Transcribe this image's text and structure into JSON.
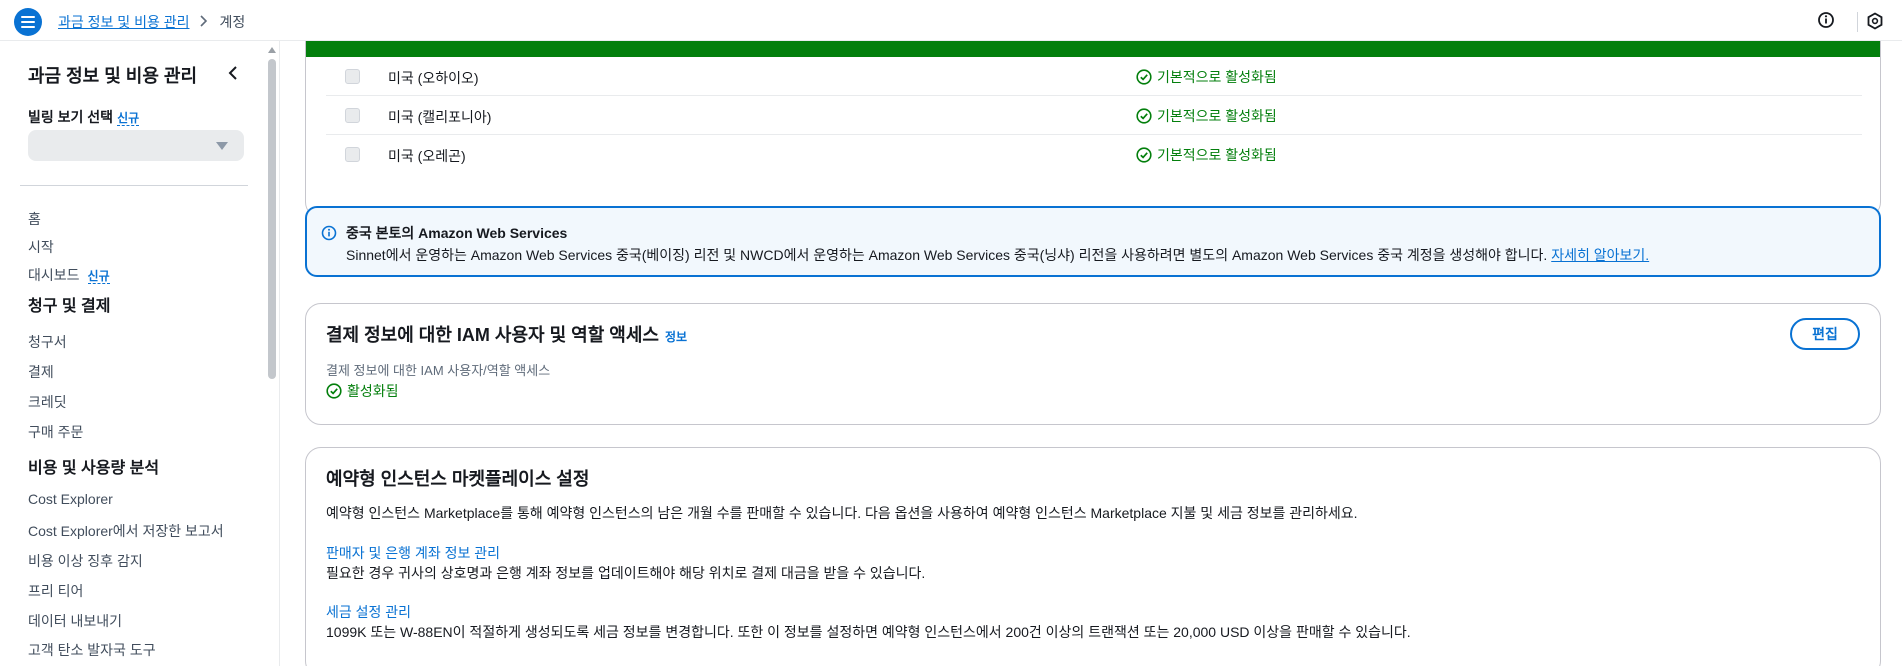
{
  "header": {
    "breadcrumb": [
      "과금 정보 및 비용 관리",
      "계정"
    ],
    "menu_icon": "hamburger-menu-icon",
    "info_icon": "info-icon",
    "settings_icon": "hexagon-settings-icon"
  },
  "sidebar": {
    "title": "과금 정보 및 비용 관리",
    "billing_view_label": "빌링 보기 선택",
    "new_badge": "신규",
    "select_value": "",
    "items_top": [
      "홈",
      "시작"
    ],
    "dashboard_label": "대시보드",
    "section_billing": "청구 및 결제",
    "billing_items": [
      "청구서",
      "결제",
      "크레딧",
      "구매 주문"
    ],
    "section_cost": "비용 및 사용량 분석",
    "cost_items": [
      "Cost Explorer",
      "Cost Explorer에서 저장한 보고서",
      "비용 이상 징후 감지",
      "프리 티어",
      "데이터 내보내기",
      "고객 탄소 발자국 도구"
    ]
  },
  "regions": {
    "rows": [
      {
        "name": "미국 (오하이오)",
        "status": "기본적으로 활성화됨"
      },
      {
        "name": "미국 (캘리포니아)",
        "status": "기본적으로 활성화됨"
      },
      {
        "name": "미국 (오레곤)",
        "status": "기본적으로 활성화됨"
      }
    ],
    "banner_color": "#037f0c"
  },
  "china_alert": {
    "title": "중국 본토의 Amazon Web Services",
    "description": "Sinnet에서 운영하는 Amazon Web Services 중국(베이징) 리전 및 NWCD에서 운영하는 Amazon Web Services 중국(닝샤) 리전을 사용하려면 별도의 Amazon Web Services 중국 계정을 생성해야 합니다.",
    "link": "자세히 알아보기."
  },
  "iam_access": {
    "title": "결제 정보에 대한 IAM 사용자 및 역할 액세스",
    "info_link": "정보",
    "edit_button": "편집",
    "label": "결제 정보에 대한 IAM 사용자/역할 액세스",
    "status": "활성화됨"
  },
  "ri_marketplace": {
    "title": "예약형 인스턴스 마켓플레이스 설정",
    "description": "예약형 인스턴스 Marketplace를 통해 예약형 인스턴스의 남은 개월 수를 판매할 수 있습니다. 다음 옵션을 사용하여 예약형 인스턴스 Marketplace 지불 및 세금 정보를 관리하세요.",
    "seller_link": "판매자 및 은행 계좌 정보 관리",
    "seller_desc": "필요한 경우 귀사의 상호명과 은행 계좌 정보를 업데이트해야 해당 위치로 결제 대금을 받을 수 있습니다.",
    "tax_link": "세금 설정 관리",
    "tax_desc": "1099K 또는 W-88EN이 적절하게 생성되도록 세금 정보를 변경합니다. 또한 이 정보를 설정하면 예약형 인스턴스에서 200건 이상의 트랜잭션 또는 20,000 USD 이상을 판매할 수 있습니다."
  },
  "colors": {
    "accent": "#0972d3",
    "success": "#037f0c"
  }
}
